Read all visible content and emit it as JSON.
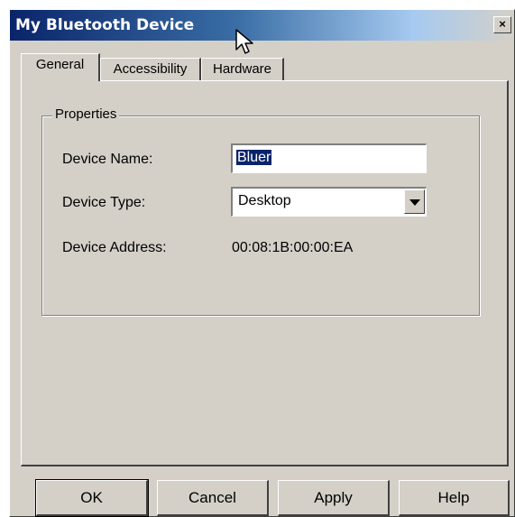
{
  "window": {
    "title": "My Bluetooth Device",
    "close_glyph": "×"
  },
  "tabs": [
    {
      "label": "General",
      "active": true
    },
    {
      "label": "Accessibility",
      "active": false
    },
    {
      "label": "Hardware",
      "active": false
    }
  ],
  "properties": {
    "group_label": "Properties",
    "device_name_label": "Device Name:",
    "device_name_value": "Bluer",
    "device_type_label": "Device Type:",
    "device_type_value": "Desktop",
    "device_address_label": "Device Address:",
    "device_address_value": "00:08:1B:00:00:EA"
  },
  "buttons": {
    "ok": "OK",
    "cancel": "Cancel",
    "apply": "Apply",
    "help": "Help"
  },
  "icons": {
    "close": "close-icon",
    "dropdown": "chevron-down-icon",
    "cursor": "mouse-cursor-icon"
  },
  "colors": {
    "title_start": "#0a246a",
    "title_end": "#a6caf0",
    "face": "#d4d0c8",
    "selection": "#0a246a"
  }
}
